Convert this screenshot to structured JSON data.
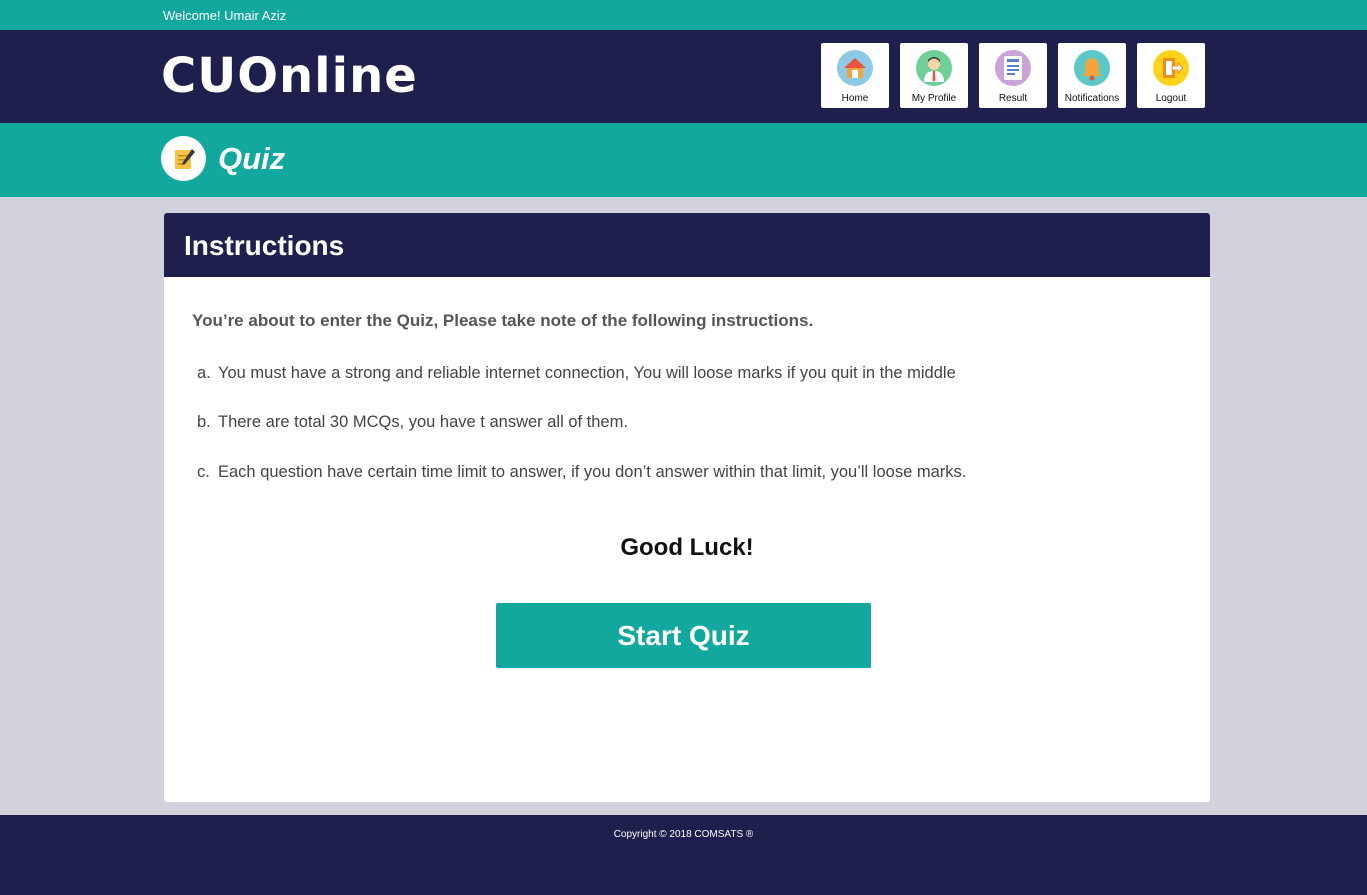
{
  "topbar": {
    "welcome": "Welcome! Umair Aziz"
  },
  "header": {
    "logo": "CUOnline",
    "nav": [
      {
        "label": "Home",
        "icon": "home-icon",
        "color": "#8ecae6"
      },
      {
        "label": "My Profile",
        "icon": "user-icon",
        "color": "#6fcf97"
      },
      {
        "label": "Result",
        "icon": "result-icon",
        "color": "#c9a3d9"
      },
      {
        "label": "Notifications",
        "icon": "bell-icon",
        "color": "#5cc8c8"
      },
      {
        "label": "Logout",
        "icon": "logout-icon",
        "color": "#ffd31a"
      }
    ]
  },
  "quizbar": {
    "title": "Quiz",
    "icon": "notepad-icon"
  },
  "card": {
    "title": "Instructions",
    "intro": "You’re about to enter the Quiz, Please take note of the following instructions.",
    "items": [
      {
        "mark": "a.",
        "text": "You must have a strong and reliable internet connection, You will loose marks if you quit in the middle"
      },
      {
        "mark": "b.",
        "text": "There are total 30 MCQs, you have t answer all of them."
      },
      {
        "mark": "c.",
        "text": "Each question have certain time limit to answer, if you don’t answer within that limit, you’ll loose marks."
      }
    ],
    "good_luck": "Good Luck!",
    "start_button": "Start Quiz"
  },
  "footer": {
    "copyright": "Copyright © 2018 COMSATS ®"
  },
  "colors": {
    "teal": "#13a89e",
    "navy": "#1f1f4e",
    "page_bg": "#d1d2dc"
  }
}
